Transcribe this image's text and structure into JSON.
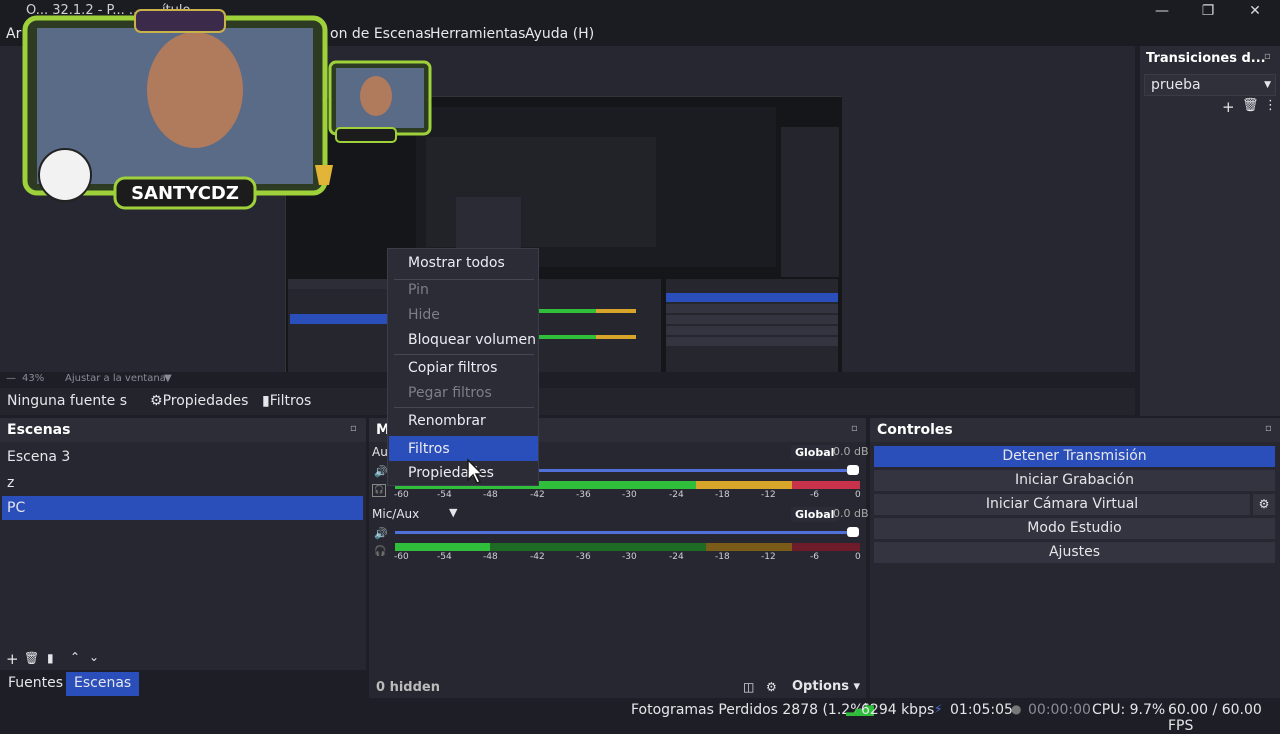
{
  "window": {
    "title": "OBS 32.1.2 - Perfil: Sin título - Escenas: Sin título",
    "title_visible": "O... 32.1.2 - P... ... ... ítulo",
    "minimize": "—",
    "maximize": "❐",
    "close": "✕"
  },
  "menubar": {
    "items": [
      "Ar",
      "on de Escenas",
      "Herramientas",
      "Ayuda (H)"
    ]
  },
  "preview": {
    "zoom": "43%",
    "fit_label": "Ajustar a la ventana"
  },
  "transitions": {
    "header": "Transiciones d...",
    "selected": "prueba"
  },
  "source_toolbar": {
    "no_source": "Ninguna fuente s",
    "properties": "Propiedades",
    "filters": "Filtros"
  },
  "scenes": {
    "header": "Escenas",
    "items": [
      {
        "label": "Escena 3"
      },
      {
        "label": "z"
      },
      {
        "label": "PC"
      }
    ],
    "tabs": {
      "sources": "Fuentes",
      "scenes": "Escenas"
    }
  },
  "mixer": {
    "header": "M",
    "tracks": [
      {
        "name": "Au",
        "global": "Global",
        "db": "0.0 dB"
      },
      {
        "name": "Mic/Aux",
        "global": "Global",
        "db": "0.0 dB"
      }
    ],
    "ticks": [
      "-60",
      "-54",
      "-48",
      "-42",
      "-36",
      "-30",
      "-24",
      "-18",
      "-12",
      "-6",
      "0"
    ],
    "hidden": "0 hidden",
    "options": "Options"
  },
  "controls": {
    "header": "Controles",
    "stop_stream": "Detener Transmisión",
    "start_record": "Iniciar Grabación",
    "start_virtualcam": "Iniciar Cámara Virtual",
    "studio_mode": "Modo Estudio",
    "settings": "Ajustes"
  },
  "context_menu": {
    "show_all": "Mostrar todos",
    "pin": "Pin",
    "hide": "Hide",
    "lock_volume": "Bloquear volumen",
    "copy_filters": "Copiar filtros",
    "paste_filters": "Pegar filtros",
    "rename": "Renombrar",
    "filters": "Filtros",
    "properties": "Propiedades"
  },
  "status": {
    "dropped": "Fotogramas Perdidos 2878 (1.2%)",
    "bitrate": "6294 kbps",
    "stream_time": "01:05:05",
    "rec_time": "00:00:00",
    "cpu": "CPU: 9.7%",
    "fps": "60.00 / 60.00 FPS"
  },
  "webcam": {
    "name_badge": "SANTYCDZ"
  },
  "colors": {
    "accent": "#2b4fba",
    "meter_green": "#2fbf3a",
    "meter_yellow": "#d8a52b",
    "meter_red": "#c8324a"
  }
}
